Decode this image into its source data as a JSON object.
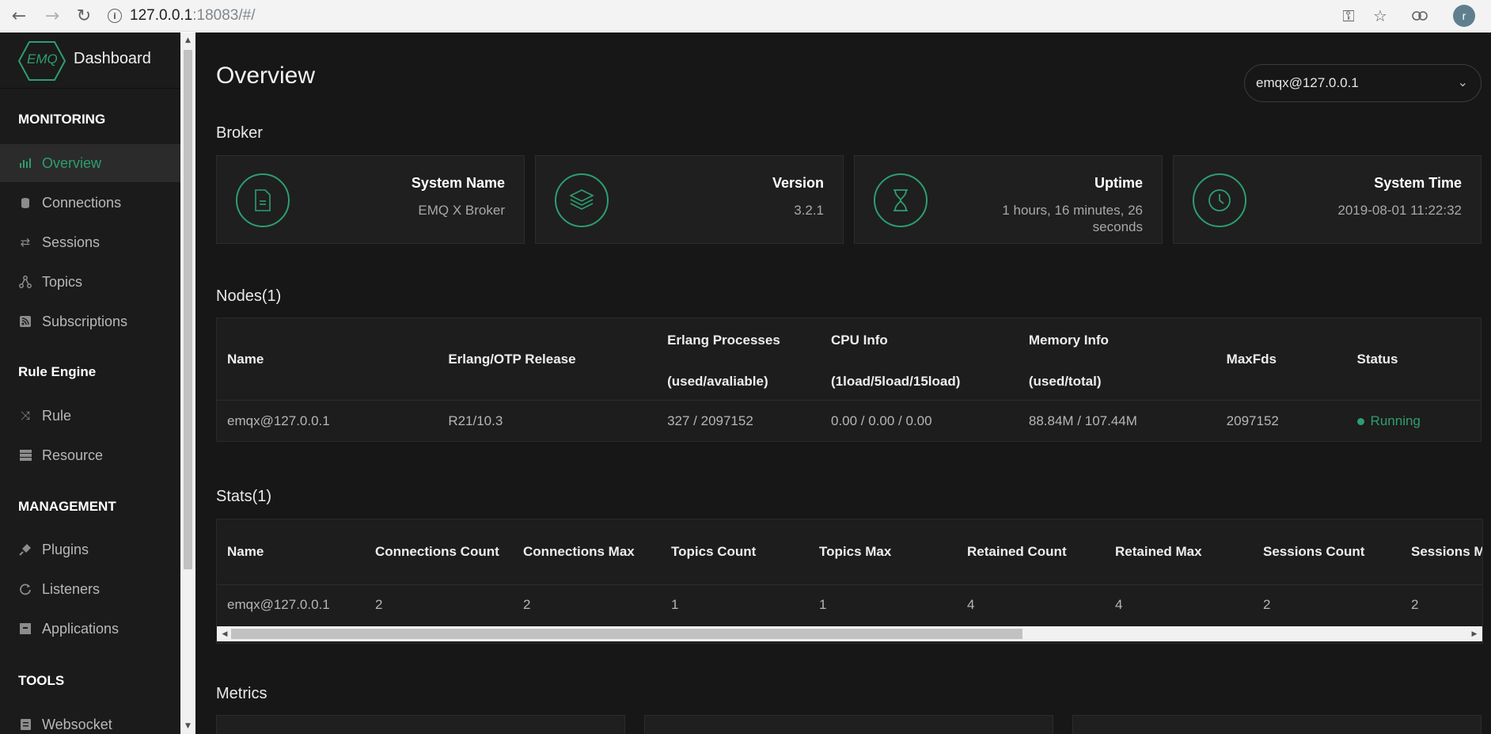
{
  "browser": {
    "url_host": "127.0.0.1",
    "url_rest": ":18083/#/"
  },
  "sidebar": {
    "logo_text": "EMQ",
    "title": "Dashboard",
    "sections": [
      {
        "title": "MONITORING",
        "items": [
          {
            "label": "Overview",
            "icon": "bar-chart-icon",
            "active": true
          },
          {
            "label": "Connections",
            "icon": "database-icon"
          },
          {
            "label": "Sessions",
            "icon": "swap-arrows-icon"
          },
          {
            "label": "Topics",
            "icon": "share-nodes-icon"
          },
          {
            "label": "Subscriptions",
            "icon": "rss-icon"
          }
        ]
      },
      {
        "title": "Rule Engine",
        "items": [
          {
            "label": "Rule",
            "icon": "shuffle-icon"
          },
          {
            "label": "Resource",
            "icon": "server-icon"
          }
        ]
      },
      {
        "title": "MANAGEMENT",
        "items": [
          {
            "label": "Plugins",
            "icon": "plug-icon"
          },
          {
            "label": "Listeners",
            "icon": "refresh-circle-icon"
          },
          {
            "label": "Applications",
            "icon": "app-box-icon"
          }
        ]
      },
      {
        "title": "TOOLS",
        "items": [
          {
            "label": "Websocket",
            "icon": "websocket-icon"
          }
        ]
      }
    ]
  },
  "main": {
    "title": "Overview",
    "node_select": "emqx@127.0.0.1",
    "broker": {
      "heading": "Broker",
      "cards": [
        {
          "title": "System Name",
          "value": "EMQ X Broker",
          "icon": "document-icon"
        },
        {
          "title": "Version",
          "value": "3.2.1",
          "icon": "layers-icon"
        },
        {
          "title": "Uptime",
          "value": "1 hours, 16 minutes, 26 seconds",
          "icon": "hourglass-icon"
        },
        {
          "title": "System Time",
          "value": "2019-08-01 11:22:32",
          "icon": "clock-icon"
        }
      ]
    },
    "nodes": {
      "heading": "Nodes(1)",
      "columns": [
        [
          "Name"
        ],
        [
          "Erlang/OTP Release"
        ],
        [
          "Erlang Processes",
          "(used/avaliable)"
        ],
        [
          "CPU Info",
          "(1load/5load/15load)"
        ],
        [
          "Memory Info",
          "(used/total)"
        ],
        [
          "MaxFds"
        ],
        [
          "Status"
        ]
      ],
      "rows": [
        [
          "emqx@127.0.0.1",
          "R21/10.3",
          "327 / 2097152",
          "0.00 / 0.00 / 0.00",
          "88.84M / 107.44M",
          "2097152",
          "Running"
        ]
      ]
    },
    "stats": {
      "heading": "Stats(1)",
      "columns": [
        "Name",
        "Connections Count",
        "Connections Max",
        "Topics Count",
        "Topics Max",
        "Retained Count",
        "Retained Max",
        "Sessions Count",
        "Sessions Max"
      ],
      "rows": [
        [
          "emqx@127.0.0.1",
          "2",
          "2",
          "1",
          "1",
          "4",
          "4",
          "2",
          "2"
        ]
      ]
    },
    "metrics": {
      "heading": "Metrics"
    }
  },
  "colors": {
    "accent": "#2d9e70",
    "sidebar_bg": "#1b1b1b",
    "main_bg": "#171717"
  }
}
